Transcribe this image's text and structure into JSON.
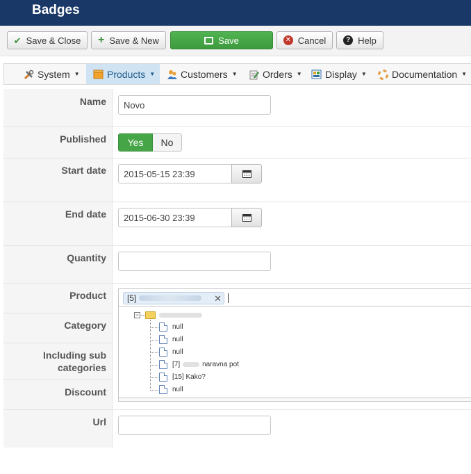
{
  "header": {
    "title": "Badges"
  },
  "toolbar": {
    "save_close": "Save & Close",
    "save_new": "Save & New",
    "save": "Save",
    "cancel": "Cancel",
    "help": "Help"
  },
  "menu": {
    "items": [
      {
        "label": "System",
        "icon": "wrench-icon"
      },
      {
        "label": "Products",
        "icon": "box-icon",
        "active": true
      },
      {
        "label": "Customers",
        "icon": "users-icon"
      },
      {
        "label": "Orders",
        "icon": "clipboard-icon"
      },
      {
        "label": "Display",
        "icon": "display-icon"
      },
      {
        "label": "Documentation",
        "icon": "lifebuoy-icon"
      }
    ]
  },
  "form": {
    "name": {
      "label": "Name",
      "value": "Novo"
    },
    "published": {
      "label": "Published",
      "yes": "Yes",
      "no": "No",
      "value": "Yes"
    },
    "start_date": {
      "label": "Start date",
      "value": "2015-05-15 23:39"
    },
    "end_date": {
      "label": "End date",
      "value": "2015-06-30 23:39"
    },
    "quantity": {
      "label": "Quantity",
      "value": ""
    },
    "product": {
      "label": "Product",
      "chip_prefix": "[5]"
    },
    "category": {
      "label": "Category"
    },
    "include_sub": {
      "label_line1": "Including sub",
      "label_line2": "categories"
    },
    "discount": {
      "label": "Discount"
    },
    "url": {
      "label": "Url",
      "value": ""
    }
  },
  "tree": {
    "items": [
      {
        "text": "null"
      },
      {
        "text": "null"
      },
      {
        "text": "null"
      },
      {
        "prefix": "[7]",
        "text": "naravna pot"
      },
      {
        "prefix": "[15]",
        "text": "Kako?"
      },
      {
        "text": "null"
      }
    ]
  },
  "colors": {
    "header": "#1a3867",
    "accent_green": "#46a546",
    "menu_active": "#cfe3f2"
  }
}
